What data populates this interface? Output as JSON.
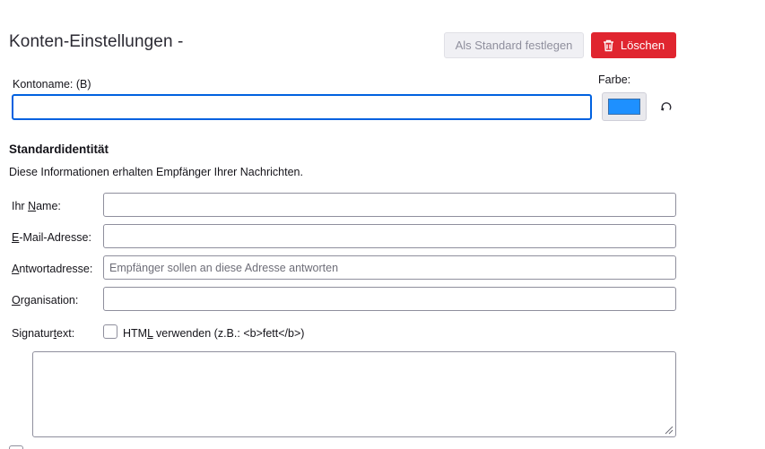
{
  "header": {
    "title": "Konten-Einstellungen -",
    "set_default_label": "Als Standard festlegen",
    "delete_label": "Löschen"
  },
  "account": {
    "name_label_pre": "Kontoname: (",
    "name_label_key": "B",
    "name_label_post": ")",
    "name_value": "",
    "color_label": "Farbe:",
    "color_value": "#1e90ff"
  },
  "identity": {
    "title": "Standardidentität",
    "description": "Diese Informationen erhalten Empfänger Ihrer Nachrichten.",
    "your_name_pre": "Ihr ",
    "your_name_key": "N",
    "your_name_post": "ame:",
    "your_name_value": "",
    "email_key": "E",
    "email_post": "-Mail-Adresse:",
    "email_value": "",
    "reply_key": "A",
    "reply_post": "ntwortadresse:",
    "reply_placeholder": "Empfänger sollen an diese Adresse antworten",
    "org_key": "O",
    "org_post": "rganisation:",
    "org_value": "",
    "signature_pre": "Signatur",
    "signature_key": "t",
    "signature_post": "ext:",
    "html_pre": "HTM",
    "html_key": "L",
    "html_post": " verwenden (z.B.: <b>fett</b>)"
  },
  "colors": {
    "accent": "#0061e0",
    "danger": "#e0252f"
  }
}
